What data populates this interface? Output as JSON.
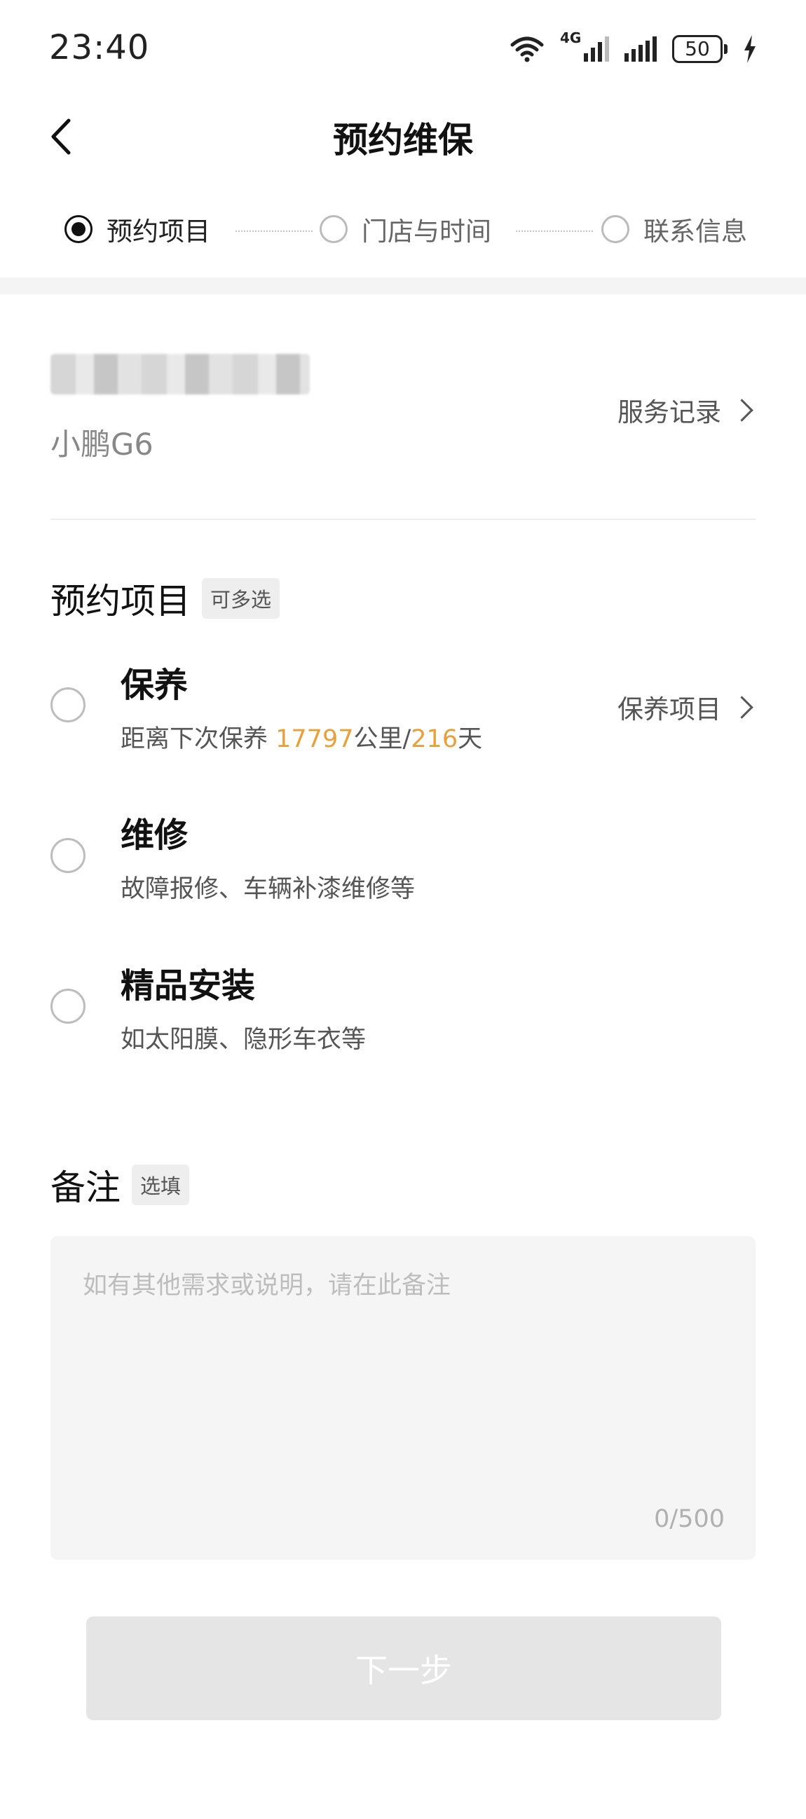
{
  "status_bar": {
    "time": "23:40",
    "network": "4G",
    "battery": "50"
  },
  "header": {
    "title": "预约维保"
  },
  "steps": [
    {
      "label": "预约项目",
      "active": true
    },
    {
      "label": "门店与时间",
      "active": false
    },
    {
      "label": "联系信息",
      "active": false
    }
  ],
  "vehicle": {
    "model": "小鹏G6",
    "service_record_label": "服务记录"
  },
  "booking": {
    "title": "预约项目",
    "tag": "可多选",
    "options": [
      {
        "title": "保养",
        "sub_prefix": "距离下次保养 ",
        "km": "17797",
        "km_unit": "公里/",
        "days": "216",
        "days_unit": "天",
        "link_label": "保养项目"
      },
      {
        "title": "维修",
        "sub": "故障报修、车辆补漆维修等"
      },
      {
        "title": "精品安装",
        "sub": "如太阳膜、隐形车衣等"
      }
    ]
  },
  "remark": {
    "title": "备注",
    "tag": "选填",
    "placeholder": "如有其他需求或说明，请在此备注",
    "counter": "0/500"
  },
  "next_button": {
    "label": "下一步"
  },
  "colors": {
    "accent_orange": "#e8a03a",
    "disabled_button": "#e5e5e5"
  }
}
